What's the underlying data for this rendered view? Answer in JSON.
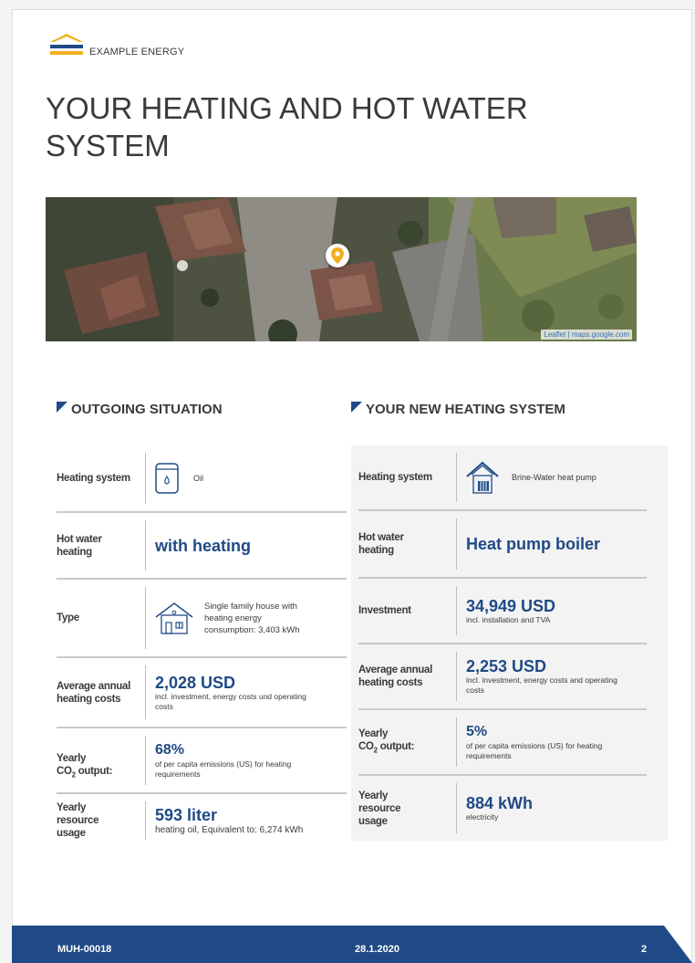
{
  "brand": {
    "name": "EXAMPLE ENERGY",
    "colors": {
      "primary": "#1f4a86",
      "accent": "#f2b01e"
    }
  },
  "page_title": "YOUR HEATING AND HOT WATER SYSTEM",
  "map": {
    "attribution": "Leaflet | maps.google.com",
    "marker_icon": "map-pin-icon"
  },
  "outgoing": {
    "heading": "OUTGOING SITUATION",
    "rows": {
      "heating_system": {
        "label": "Heating system",
        "icon": "oil-tank-icon",
        "value": "Oil"
      },
      "hot_water": {
        "label": "Hot water heating",
        "value": "with heating"
      },
      "type": {
        "label": "Type",
        "icon": "house-icon",
        "value": "Single family house with heating energy consumption: 3,403 kWh"
      },
      "annual_costs": {
        "label": "Average annual heating costs",
        "value": "2,028 USD",
        "note": "incl. investment, energy costs und operating costs"
      },
      "co2": {
        "label_prefix": "Yearly",
        "label_co": "CO",
        "label_sub": "2",
        "label_suffix": " output:",
        "value": "68%",
        "note": "of per capita emissions (US) for heating requirements"
      },
      "resource": {
        "label": "Yearly resource usage",
        "value": "593 liter",
        "note": "heating oil, Equivalent to: 6,274 kWh"
      }
    }
  },
  "new_system": {
    "heading": "YOUR NEW HEATING SYSTEM",
    "rows": {
      "heating_system": {
        "label": "Heating system",
        "icon": "heat-pump-icon",
        "value": "Brine-Water heat pump"
      },
      "hot_water": {
        "label": "Hot water heating",
        "value": "Heat pump boiler"
      },
      "investment": {
        "label": "Investment",
        "value": "34,949 USD",
        "note": "incl. installation and TVA"
      },
      "annual_costs": {
        "label": "Average annual heating costs",
        "value": "2,253 USD",
        "note": "incl. investment, energy costs and operating costs"
      },
      "co2": {
        "label_prefix": "Yearly",
        "label_co": "CO",
        "label_sub": "2",
        "label_suffix": " output:",
        "value": "5%",
        "note": "of per capita emissions (US) for heating requirements"
      },
      "resource": {
        "label": "Yearly resource usage",
        "value": "884 kWh",
        "note": "electricity"
      }
    }
  },
  "footer": {
    "doc_id": "MUH-00018",
    "date": "28.1.2020",
    "page_number": "2"
  }
}
